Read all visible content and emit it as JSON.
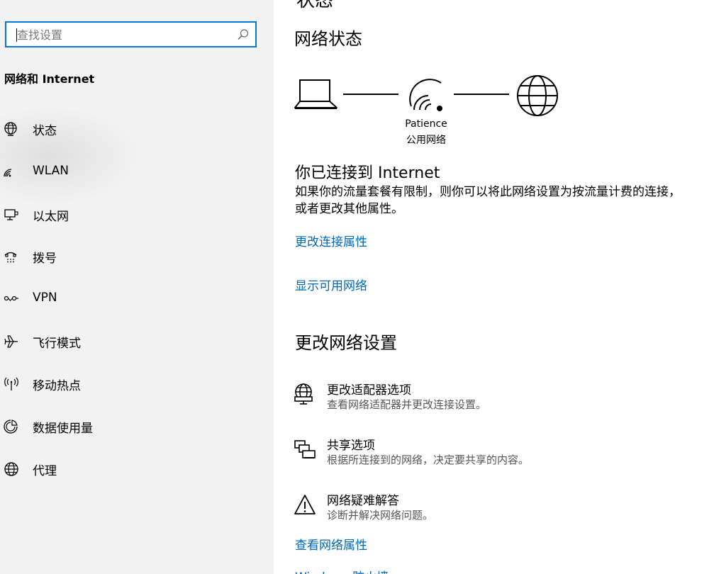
{
  "search": {
    "placeholder": "查找设置"
  },
  "sidebar": {
    "section_title": "网络和 Internet",
    "items": [
      {
        "label": "状态",
        "icon": "home-globe-icon"
      },
      {
        "label": "WLAN",
        "icon": "wifi-icon"
      },
      {
        "label": "以太网",
        "icon": "ethernet-icon"
      },
      {
        "label": "拨号",
        "icon": "dialup-icon"
      },
      {
        "label": "VPN",
        "icon": "vpn-icon"
      },
      {
        "label": "飞行模式",
        "icon": "airplane-icon"
      },
      {
        "label": "移动热点",
        "icon": "hotspot-icon"
      },
      {
        "label": "数据使用量",
        "icon": "data-usage-icon"
      },
      {
        "label": "代理",
        "icon": "globe-icon"
      }
    ]
  },
  "main": {
    "top_cut_text": "状态",
    "status_heading": "网络状态",
    "network_name": "Patience",
    "network_type": "公用网络",
    "connected_title": "你已连接到 Internet",
    "connected_desc": "如果你的流量套餐有限制，则你可以将此网络设置为按流量计费的连接，或者更改其他属性。",
    "link_change_props": "更改连接属性",
    "link_show_networks": "显示可用网络",
    "change_heading": "更改网络设置",
    "options": [
      {
        "title": "更改适配器选项",
        "desc": "查看网络适配器并更改连接设置。",
        "icon": "adapter-icon"
      },
      {
        "title": "共享选项",
        "desc": "根据所连接到的网络，决定要共享的内容。",
        "icon": "sharing-icon"
      },
      {
        "title": "网络疑难解答",
        "desc": "诊断并解决网络问题。",
        "icon": "warning-icon"
      }
    ],
    "link_view_props": "查看网络属性",
    "bottom_cut_text": "Windows 防火墙"
  },
  "colors": {
    "accent": "#0078d7",
    "link": "#0067b8",
    "sidebar_bg": "#f2f2f2"
  }
}
